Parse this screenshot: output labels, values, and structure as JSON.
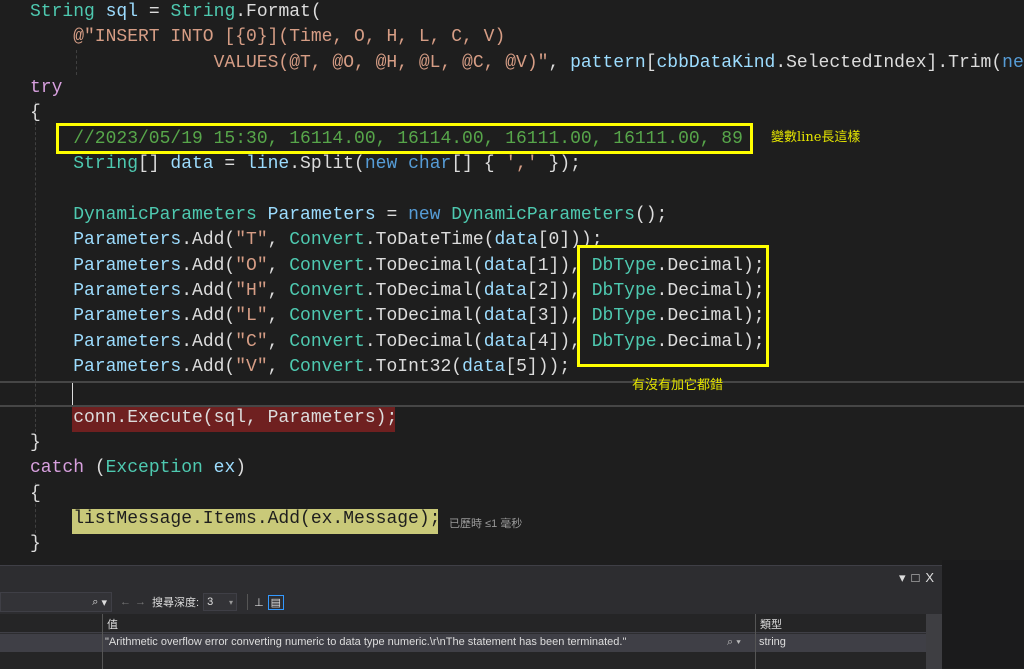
{
  "code": {
    "lines": [
      {
        "indent": 0,
        "tokens": [
          {
            "t": "String",
            "c": "ty"
          },
          {
            "t": " ",
            "c": "tx"
          },
          {
            "t": "sql",
            "c": "id"
          },
          {
            "t": " = ",
            "c": "tx"
          },
          {
            "t": "String",
            "c": "ty"
          },
          {
            "t": ".Format(",
            "c": "tx"
          }
        ]
      },
      {
        "indent": 4,
        "tokens": [
          {
            "t": "@\"INSERT INTO [{0}](Time, O, H, L, C, V)",
            "c": "st"
          }
        ]
      },
      {
        "indent": 17,
        "tokens": [
          {
            "t": "VALUES(@T, @O, @H, @L, @C, @V)\"",
            "c": "st"
          },
          {
            "t": ", ",
            "c": "tx"
          },
          {
            "t": "pattern",
            "c": "id"
          },
          {
            "t": "[",
            "c": "tx"
          },
          {
            "t": "cbbDataKind",
            "c": "id"
          },
          {
            "t": ".SelectedIndex].Trim(",
            "c": "tx"
          },
          {
            "t": "new",
            "c": "kw"
          }
        ]
      },
      {
        "indent": 0,
        "tokens": [
          {
            "t": "try",
            "c": "pu"
          }
        ]
      },
      {
        "indent": 0,
        "tokens": [
          {
            "t": "{",
            "c": "tx"
          }
        ]
      },
      {
        "indent": 4,
        "tokens": [
          {
            "t": "//2023/05/19 15:30, 16114.00, 16114.00, 16111.00, 16111.00, 89",
            "c": "cm"
          }
        ]
      },
      {
        "indent": 4,
        "tokens": [
          {
            "t": "String",
            "c": "ty"
          },
          {
            "t": "[] ",
            "c": "tx"
          },
          {
            "t": "data",
            "c": "id"
          },
          {
            "t": " = ",
            "c": "tx"
          },
          {
            "t": "line",
            "c": "id"
          },
          {
            "t": ".Split(",
            "c": "tx"
          },
          {
            "t": "new",
            "c": "kw"
          },
          {
            "t": " ",
            "c": "tx"
          },
          {
            "t": "char",
            "c": "kw"
          },
          {
            "t": "[] { ",
            "c": "tx"
          },
          {
            "t": "','",
            "c": "st"
          },
          {
            "t": " });",
            "c": "tx"
          }
        ]
      },
      {
        "indent": 0,
        "tokens": []
      },
      {
        "indent": 4,
        "tokens": [
          {
            "t": "DynamicParameters",
            "c": "ty"
          },
          {
            "t": " ",
            "c": "tx"
          },
          {
            "t": "Parameters",
            "c": "id"
          },
          {
            "t": " = ",
            "c": "tx"
          },
          {
            "t": "new",
            "c": "kw"
          },
          {
            "t": " ",
            "c": "tx"
          },
          {
            "t": "DynamicParameters",
            "c": "ty"
          },
          {
            "t": "();",
            "c": "tx"
          }
        ]
      },
      {
        "indent": 4,
        "tokens": [
          {
            "t": "Parameters",
            "c": "id"
          },
          {
            "t": ".Add(",
            "c": "tx"
          },
          {
            "t": "\"T\"",
            "c": "st"
          },
          {
            "t": ", ",
            "c": "tx"
          },
          {
            "t": "Convert",
            "c": "ty"
          },
          {
            "t": ".ToDateTime(",
            "c": "tx"
          },
          {
            "t": "data",
            "c": "id"
          },
          {
            "t": "[0]));",
            "c": "tx"
          }
        ]
      },
      {
        "indent": 4,
        "tokens": [
          {
            "t": "Parameters",
            "c": "id"
          },
          {
            "t": ".Add(",
            "c": "tx"
          },
          {
            "t": "\"O\"",
            "c": "st"
          },
          {
            "t": ", ",
            "c": "tx"
          },
          {
            "t": "Convert",
            "c": "ty"
          },
          {
            "t": ".ToDecimal(",
            "c": "tx"
          },
          {
            "t": "data",
            "c": "id"
          },
          {
            "t": "[1]), ",
            "c": "tx"
          },
          {
            "t": "DbType",
            "c": "ty"
          },
          {
            "t": ".Decimal);",
            "c": "tx"
          }
        ]
      },
      {
        "indent": 4,
        "tokens": [
          {
            "t": "Parameters",
            "c": "id"
          },
          {
            "t": ".Add(",
            "c": "tx"
          },
          {
            "t": "\"H\"",
            "c": "st"
          },
          {
            "t": ", ",
            "c": "tx"
          },
          {
            "t": "Convert",
            "c": "ty"
          },
          {
            "t": ".ToDecimal(",
            "c": "tx"
          },
          {
            "t": "data",
            "c": "id"
          },
          {
            "t": "[2]), ",
            "c": "tx"
          },
          {
            "t": "DbType",
            "c": "ty"
          },
          {
            "t": ".Decimal);",
            "c": "tx"
          }
        ]
      },
      {
        "indent": 4,
        "tokens": [
          {
            "t": "Parameters",
            "c": "id"
          },
          {
            "t": ".Add(",
            "c": "tx"
          },
          {
            "t": "\"L\"",
            "c": "st"
          },
          {
            "t": ", ",
            "c": "tx"
          },
          {
            "t": "Convert",
            "c": "ty"
          },
          {
            "t": ".ToDecimal(",
            "c": "tx"
          },
          {
            "t": "data",
            "c": "id"
          },
          {
            "t": "[3]), ",
            "c": "tx"
          },
          {
            "t": "DbType",
            "c": "ty"
          },
          {
            "t": ".Decimal);",
            "c": "tx"
          }
        ]
      },
      {
        "indent": 4,
        "tokens": [
          {
            "t": "Parameters",
            "c": "id"
          },
          {
            "t": ".Add(",
            "c": "tx"
          },
          {
            "t": "\"C\"",
            "c": "st"
          },
          {
            "t": ", ",
            "c": "tx"
          },
          {
            "t": "Convert",
            "c": "ty"
          },
          {
            "t": ".ToDecimal(",
            "c": "tx"
          },
          {
            "t": "data",
            "c": "id"
          },
          {
            "t": "[4]), ",
            "c": "tx"
          },
          {
            "t": "DbType",
            "c": "ty"
          },
          {
            "t": ".Decimal);",
            "c": "tx"
          }
        ]
      },
      {
        "indent": 4,
        "tokens": [
          {
            "t": "Parameters",
            "c": "id"
          },
          {
            "t": ".Add(",
            "c": "tx"
          },
          {
            "t": "\"V\"",
            "c": "st"
          },
          {
            "t": ", ",
            "c": "tx"
          },
          {
            "t": "Convert",
            "c": "ty"
          },
          {
            "t": ".ToInt32(",
            "c": "tx"
          },
          {
            "t": "data",
            "c": "id"
          },
          {
            "t": "[5]));",
            "c": "tx"
          }
        ]
      },
      {
        "indent": 0,
        "tokens": []
      },
      {
        "indent": 4,
        "tokens": [
          {
            "t": "conn.Execute(sql, Parameters);",
            "c": "tx"
          }
        ]
      },
      {
        "indent": 0,
        "tokens": [
          {
            "t": "}",
            "c": "tx"
          }
        ]
      },
      {
        "indent": 0,
        "tokens": [
          {
            "t": "catch",
            "c": "pu"
          },
          {
            "t": " (",
            "c": "tx"
          },
          {
            "t": "Exception",
            "c": "ty"
          },
          {
            "t": " ",
            "c": "tx"
          },
          {
            "t": "ex",
            "c": "id"
          },
          {
            "t": ")",
            "c": "tx"
          }
        ]
      },
      {
        "indent": 0,
        "tokens": [
          {
            "t": "{",
            "c": "tx"
          }
        ]
      },
      {
        "indent": 4,
        "tokens": [
          {
            "t": "listMessage.Items.Add(ex.Message);",
            "c": "yl"
          }
        ]
      },
      {
        "indent": 0,
        "tokens": [
          {
            "t": "}",
            "c": "tx"
          }
        ]
      }
    ]
  },
  "annotations": {
    "line_note": "變數line長這樣",
    "dbtype_note": "有沒有加它都錯",
    "elapsed": "已歷時 ≤1 毫秒"
  },
  "panel": {
    "window_buttons": [
      "▾",
      "□",
      "X"
    ],
    "search_icon": "⌕",
    "search_depth_label": "搜尋深度:",
    "search_depth_value": "3",
    "columns": {
      "value": "值",
      "type": "類型"
    },
    "rows": [
      {
        "value": "\"Arithmetic overflow error converting numeric to data type numeric.\\r\\nThe statement has been terminated.\"",
        "type": "string"
      }
    ]
  },
  "colors": {
    "highlight_box": "#ffff00",
    "error_line": "#6f2020",
    "current_stmt": "#c9c979"
  }
}
